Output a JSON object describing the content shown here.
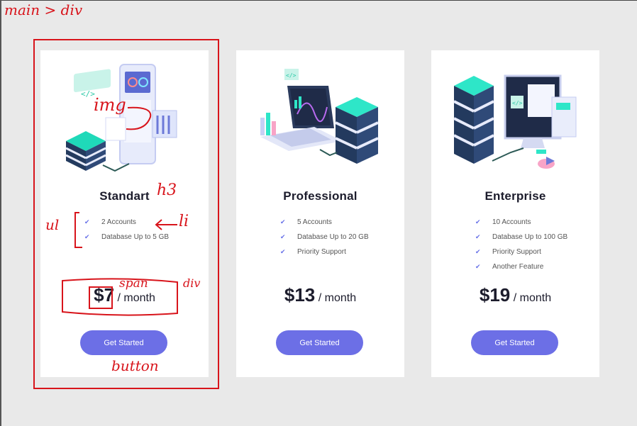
{
  "cards": [
    {
      "title": "Standart",
      "features": [
        {
          "label": "2 Accounts",
          "icon": "check-icon"
        },
        {
          "label": "Database Up to 5 GB",
          "icon": "check-icon"
        }
      ],
      "price": {
        "amount": "$7",
        "period": " / month"
      },
      "button_label": "Get Started",
      "illustration": "server-tablet-illustration"
    },
    {
      "title": "Professional",
      "features": [
        {
          "label": "5 Accounts",
          "icon": "check-icon"
        },
        {
          "label": "Database Up to 20 GB",
          "icon": "check-icon"
        },
        {
          "label": "Priority Support",
          "icon": "check-icon"
        }
      ],
      "price": {
        "amount": "$13",
        "period": " / month"
      },
      "button_label": "Get Started",
      "illustration": "laptop-server-illustration"
    },
    {
      "title": "Enterprise",
      "features": [
        {
          "label": "10 Accounts",
          "icon": "check-icon"
        },
        {
          "label": "Database Up to 100 GB",
          "icon": "check-icon"
        },
        {
          "label": "Priority Support",
          "icon": "check-icon"
        },
        {
          "label": "Another Feature",
          "icon": "check-icon"
        }
      ],
      "price": {
        "amount": "$19",
        "period": " / month"
      },
      "button_label": "Get Started",
      "illustration": "server-desktop-illustration"
    }
  ],
  "annotations": {
    "main_div": "main > div",
    "img": "img",
    "h3": "h3",
    "ul": "ul",
    "li": "li",
    "span": "span",
    "div": "div",
    "button": "button"
  },
  "colors": {
    "accent": "#6c6fe6",
    "annotation": "#d8141b",
    "background": "#e9e9e9",
    "card": "#ffffff",
    "teal": "#2ee6c8"
  }
}
